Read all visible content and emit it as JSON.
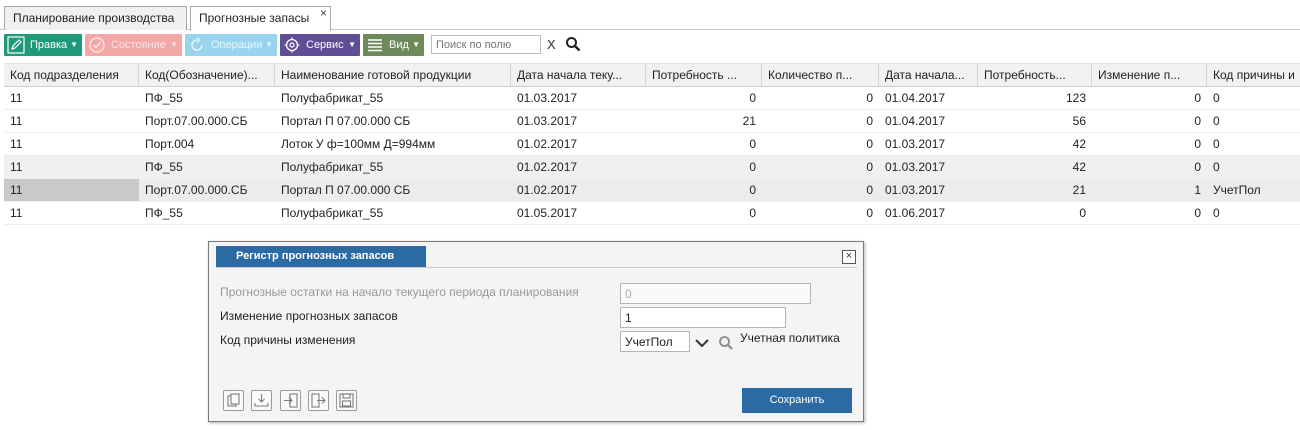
{
  "tabs": [
    {
      "label": "Планирование производства"
    },
    {
      "label": "Прогнозные запасы",
      "close": "×"
    }
  ],
  "toolbar": {
    "edit": "Правка",
    "state": "Состояние",
    "ops": "Операции",
    "service": "Сервис",
    "view": "Вид",
    "search_placeholder": "Поиск по полю",
    "clear": "X"
  },
  "colors": {
    "edit": "#1e9a7a",
    "state": "#f3a7a7",
    "ops": "#98d4ee",
    "service": "#5d4e96",
    "view": "#6f8a5a",
    "accent": "#2c6aa3"
  },
  "table": {
    "columns": [
      "Код подразделения",
      "Код(Обозначение)...",
      "Наименование готовой продукции",
      "Дата начала теку...",
      "Потребность ...",
      "Количество п...",
      "Дата начала...",
      "Потребность...",
      "Изменение п...",
      "Код причины и"
    ],
    "rows": [
      [
        "11",
        "ПФ_55",
        "Полуфабрикат_55",
        "01.03.2017",
        "0",
        "0",
        "01.04.2017",
        "123",
        "0",
        "0"
      ],
      [
        "11",
        "Порт.07.00.000.СБ",
        "Портал П 07.00.000 СБ",
        "01.03.2017",
        "21",
        "0",
        "01.04.2017",
        "56",
        "0",
        "0"
      ],
      [
        "11",
        "Порт.004",
        "Лоток У ф=100мм Д=994мм",
        "01.02.2017",
        "0",
        "0",
        "01.03.2017",
        "42",
        "0",
        "0"
      ],
      [
        "11",
        "ПФ_55",
        "Полуфабрикат_55",
        "01.02.2017",
        "0",
        "0",
        "01.03.2017",
        "42",
        "0",
        "0"
      ],
      [
        "11",
        "Порт.07.00.000.СБ",
        "Портал П 07.00.000 СБ",
        "01.02.2017",
        "0",
        "0",
        "01.03.2017",
        "21",
        "1",
        "УчетПол"
      ],
      [
        "11",
        "ПФ_55",
        "Полуфабрикат_55",
        "01.05.2017",
        "0",
        "0",
        "01.06.2017",
        "0",
        "0",
        "0"
      ]
    ]
  },
  "dialog": {
    "title": "Регистр прогнозных запасов",
    "close": "×",
    "fields": [
      {
        "label": "Прогнозные остатки на начало текущего периода планирования",
        "value": "0"
      },
      {
        "label": "Изменение прогнозных запасов",
        "value": "1"
      },
      {
        "label": "Код причины изменения",
        "value": "УчетПол",
        "description": "Учетная политика"
      }
    ],
    "save": "Сохранить"
  }
}
